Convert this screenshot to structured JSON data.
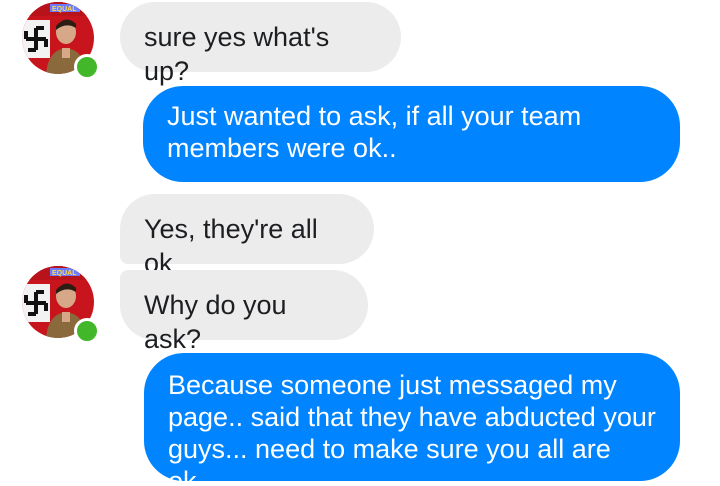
{
  "colors": {
    "outgoing_bubble": "#0084ff",
    "incoming_bubble": "#ececec",
    "online_indicator": "#42b72a"
  },
  "contact": {
    "avatar_icon": "profile-picture-icon",
    "avatar_text": "EQUAL",
    "status_icon": "online-status-icon"
  },
  "messages": [
    {
      "direction": "incoming",
      "text": "sure yes what's up?"
    },
    {
      "direction": "outgoing",
      "text": "Just wanted to ask, if all your team members were ok.."
    },
    {
      "direction": "incoming",
      "text": "Yes, they're all ok"
    },
    {
      "direction": "incoming",
      "text": "Why do you ask?"
    },
    {
      "direction": "outgoing",
      "text": "Because someone just messaged my page.. said that they have abducted your guys... need to make sure you all are ok.."
    }
  ]
}
